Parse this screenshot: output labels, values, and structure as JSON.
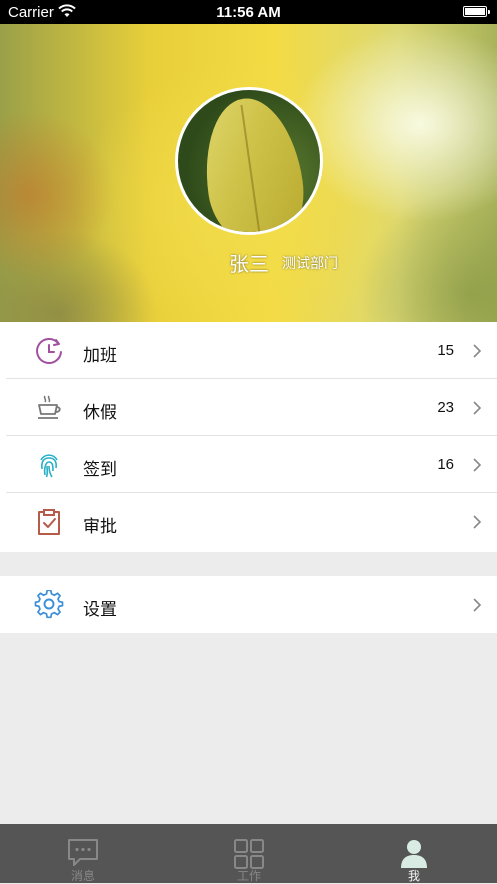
{
  "status_bar": {
    "carrier": "Carrier",
    "time": "11:56 AM"
  },
  "profile": {
    "name": "张三",
    "department": "测试部门"
  },
  "menu": [
    {
      "label": "加班",
      "count": "15",
      "icon": "clock-icon",
      "color": "#a0509e"
    },
    {
      "label": "休假",
      "count": "23",
      "icon": "coffee-cup-icon",
      "color": "#777777"
    },
    {
      "label": "签到",
      "count": "16",
      "icon": "fingerprint-icon",
      "color": "#2ab0c6"
    },
    {
      "label": "审批",
      "count": "",
      "icon": "clipboard-check-icon",
      "color": "#b65a4c"
    }
  ],
  "settings": {
    "label": "设置",
    "icon": "gear-icon",
    "color": "#3c8fd6"
  },
  "tabbar": {
    "tabs": [
      {
        "label": "消息",
        "icon": "message-icon",
        "active": false
      },
      {
        "label": "工作",
        "icon": "grid-icon",
        "active": false
      },
      {
        "label": "我",
        "icon": "person-icon",
        "active": true
      }
    ],
    "active_color": "#d8ece4",
    "inactive_color": "#888888"
  }
}
